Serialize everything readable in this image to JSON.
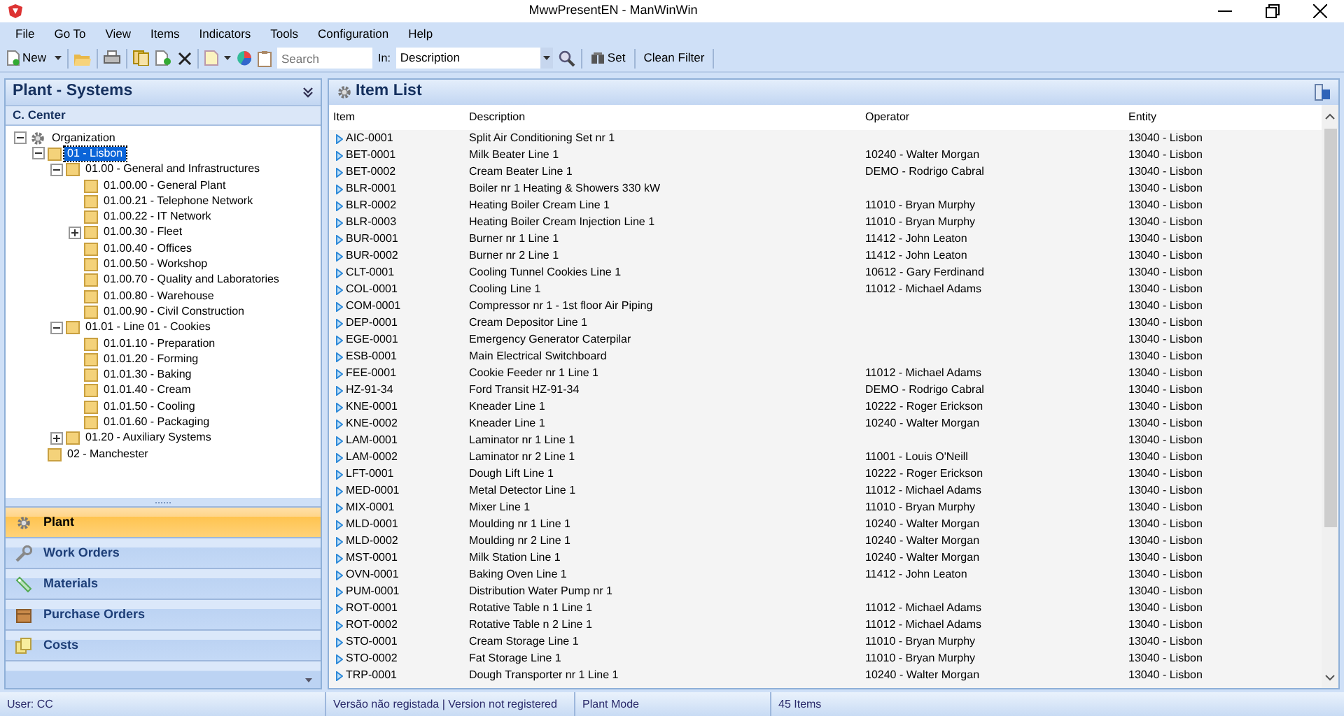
{
  "window": {
    "title": "MwwPresentEN - ManWinWin"
  },
  "menu": [
    "File",
    "Go To",
    "View",
    "Items",
    "Indicators",
    "Tools",
    "Configuration",
    "Help"
  ],
  "toolbar": {
    "new_label": "New",
    "search": {
      "placeholder": "Search"
    },
    "in_label": "In:",
    "in_value": "Description",
    "set_label": "Set",
    "clean_filter_label": "Clean Filter"
  },
  "left_panel": {
    "title": "Plant - Systems",
    "subtitle": "C. Center",
    "tree": [
      {
        "label": "Organization",
        "kind": "root",
        "expanded": true,
        "selected": false,
        "children": [
          {
            "label": "01 - Lisbon",
            "kind": "folder",
            "expanded": true,
            "selected": true,
            "children": [
              {
                "label": "01.00 - General and Infrastructures",
                "kind": "folder",
                "expanded": true,
                "selected": false,
                "children": [
                  {
                    "label": "01.00.00 - General Plant",
                    "kind": "folder",
                    "selected": false
                  },
                  {
                    "label": "01.00.21 - Telephone Network",
                    "kind": "folder",
                    "selected": false
                  },
                  {
                    "label": "01.00.22 - IT Network",
                    "kind": "folder",
                    "selected": false
                  },
                  {
                    "label": "01.00.30 - Fleet",
                    "kind": "folder",
                    "expanded": false,
                    "selected": false
                  },
                  {
                    "label": "01.00.40 - Offices",
                    "kind": "folder",
                    "selected": false
                  },
                  {
                    "label": "01.00.50 - Workshop",
                    "kind": "folder",
                    "selected": false
                  },
                  {
                    "label": "01.00.70 - Quality and Laboratories",
                    "kind": "folder",
                    "selected": false
                  },
                  {
                    "label": "01.00.80 - Warehouse",
                    "kind": "folder",
                    "selected": false
                  },
                  {
                    "label": "01.00.90 - Civil Construction",
                    "kind": "folder",
                    "selected": false
                  }
                ]
              },
              {
                "label": "01.01 - Line 01 - Cookies",
                "kind": "folder",
                "expanded": true,
                "selected": false,
                "children": [
                  {
                    "label": "01.01.10 - Preparation",
                    "kind": "folder",
                    "selected": false
                  },
                  {
                    "label": "01.01.20 - Forming",
                    "kind": "folder",
                    "selected": false
                  },
                  {
                    "label": "01.01.30 - Baking",
                    "kind": "folder",
                    "selected": false
                  },
                  {
                    "label": "01.01.40 - Cream",
                    "kind": "folder",
                    "selected": false
                  },
                  {
                    "label": "01.01.50 - Cooling",
                    "kind": "folder",
                    "selected": false
                  },
                  {
                    "label": "01.01.60 - Packaging",
                    "kind": "folder",
                    "selected": false
                  }
                ]
              },
              {
                "label": "01.20 - Auxiliary Systems",
                "kind": "folder",
                "expanded": false,
                "selected": false
              }
            ]
          },
          {
            "label": "02 - Manchester",
            "kind": "folder",
            "selected": false
          }
        ]
      }
    ],
    "nav": [
      {
        "label": "Plant",
        "kind": "gear",
        "selected": true
      },
      {
        "label": "Work Orders",
        "kind": "wrench",
        "selected": false
      },
      {
        "label": "Materials",
        "kind": "tag",
        "selected": false
      },
      {
        "label": "Purchase Orders",
        "kind": "box",
        "selected": false
      },
      {
        "label": "Costs",
        "kind": "pages",
        "selected": false
      }
    ]
  },
  "item_list": {
    "title": "Item List",
    "columns": [
      "Item",
      "Description",
      "Operator",
      "Entity"
    ],
    "rows": [
      [
        "AIC-0001",
        "Split Air Conditioning Set nr 1",
        "",
        "13040 - Lisbon"
      ],
      [
        "BET-0001",
        "Milk Beater Line 1",
        "10240 - Walter Morgan",
        "13040 - Lisbon"
      ],
      [
        "BET-0002",
        "Cream Beater Line 1",
        "DEMO - Rodrigo Cabral",
        "13040 - Lisbon"
      ],
      [
        "BLR-0001",
        "Boiler nr 1 Heating & Showers 330 kW",
        "",
        "13040 - Lisbon"
      ],
      [
        "BLR-0002",
        "Heating Boiler Cream Line 1",
        "11010 - Bryan Murphy",
        "13040 - Lisbon"
      ],
      [
        "BLR-0003",
        "Heating Boiler Cream Injection Line 1",
        "11010 - Bryan Murphy",
        "13040 - Lisbon"
      ],
      [
        "BUR-0001",
        "Burner nr 1 Line 1",
        "11412 - John Leaton",
        "13040 - Lisbon"
      ],
      [
        "BUR-0002",
        "Burner nr 2 Line 1",
        "11412 - John Leaton",
        "13040 - Lisbon"
      ],
      [
        "CLT-0001",
        "Cooling Tunnel Cookies Line 1",
        "10612 - Gary Ferdinand",
        "13040 - Lisbon"
      ],
      [
        "COL-0001",
        "Cooling Line 1",
        "11012 - Michael Adams",
        "13040 - Lisbon"
      ],
      [
        "COM-0001",
        "Compressor nr 1 - 1st floor Air Piping",
        "",
        "13040 - Lisbon"
      ],
      [
        "DEP-0001",
        "Cream Depositor Line 1",
        "",
        "13040 - Lisbon"
      ],
      [
        "EGE-0001",
        "Emergency Generator Caterpilar",
        "",
        "13040 - Lisbon"
      ],
      [
        "ESB-0001",
        "Main Electrical Switchboard",
        "",
        "13040 - Lisbon"
      ],
      [
        "FEE-0001",
        "Cookie Feeder nr 1 Line 1",
        "11012 - Michael Adams",
        "13040 - Lisbon"
      ],
      [
        "HZ-91-34",
        "Ford Transit HZ-91-34",
        "DEMO - Rodrigo Cabral",
        "13040 - Lisbon"
      ],
      [
        "KNE-0001",
        "Kneader Line 1",
        "10222 - Roger Erickson",
        "13040 - Lisbon"
      ],
      [
        "KNE-0002",
        "Kneader Line 1",
        "10240 - Walter Morgan",
        "13040 - Lisbon"
      ],
      [
        "LAM-0001",
        "Laminator nr 1 Line 1",
        "",
        "13040 - Lisbon"
      ],
      [
        "LAM-0002",
        "Laminator nr 2 Line 1",
        "11001 - Louis O'Neill",
        "13040 - Lisbon"
      ],
      [
        "LFT-0001",
        "Dough Lift Line 1",
        "10222 - Roger Erickson",
        "13040 - Lisbon"
      ],
      [
        "MED-0001",
        "Metal Detector Line 1",
        "11012 - Michael Adams",
        "13040 - Lisbon"
      ],
      [
        "MIX-0001",
        "Mixer Line 1",
        "11010 - Bryan Murphy",
        "13040 - Lisbon"
      ],
      [
        "MLD-0001",
        "Moulding nr 1 Line 1",
        "10240 - Walter Morgan",
        "13040 - Lisbon"
      ],
      [
        "MLD-0002",
        "Moulding nr 2 Line 1",
        "10240 - Walter Morgan",
        "13040 - Lisbon"
      ],
      [
        "MST-0001",
        "Milk Station Line 1",
        "10240 - Walter Morgan",
        "13040 - Lisbon"
      ],
      [
        "OVN-0001",
        "Baking Oven Line 1",
        "11412 - John Leaton",
        "13040 - Lisbon"
      ],
      [
        "PUM-0001",
        "Distribution Water Pump nr 1",
        "",
        "13040 - Lisbon"
      ],
      [
        "ROT-0001",
        "Rotative Table n 1 Line 1",
        "11012 - Michael Adams",
        "13040 - Lisbon"
      ],
      [
        "ROT-0002",
        "Rotative Table n 2 Line 1",
        "11012 - Michael Adams",
        "13040 - Lisbon"
      ],
      [
        "STO-0001",
        "Cream Storage Line 1",
        "11010 - Bryan Murphy",
        "13040 - Lisbon"
      ],
      [
        "STO-0002",
        "Fat Storage Line 1",
        "11010 - Bryan Murphy",
        "13040 - Lisbon"
      ],
      [
        "TRP-0001",
        "Dough Transporter nr 1 Line 1",
        "10240 - Walter Morgan",
        "13040 - Lisbon"
      ]
    ]
  },
  "status_bar": [
    "User: CC",
    "Versão não registada | Version not registered",
    "Plant Mode",
    "45 Items"
  ]
}
